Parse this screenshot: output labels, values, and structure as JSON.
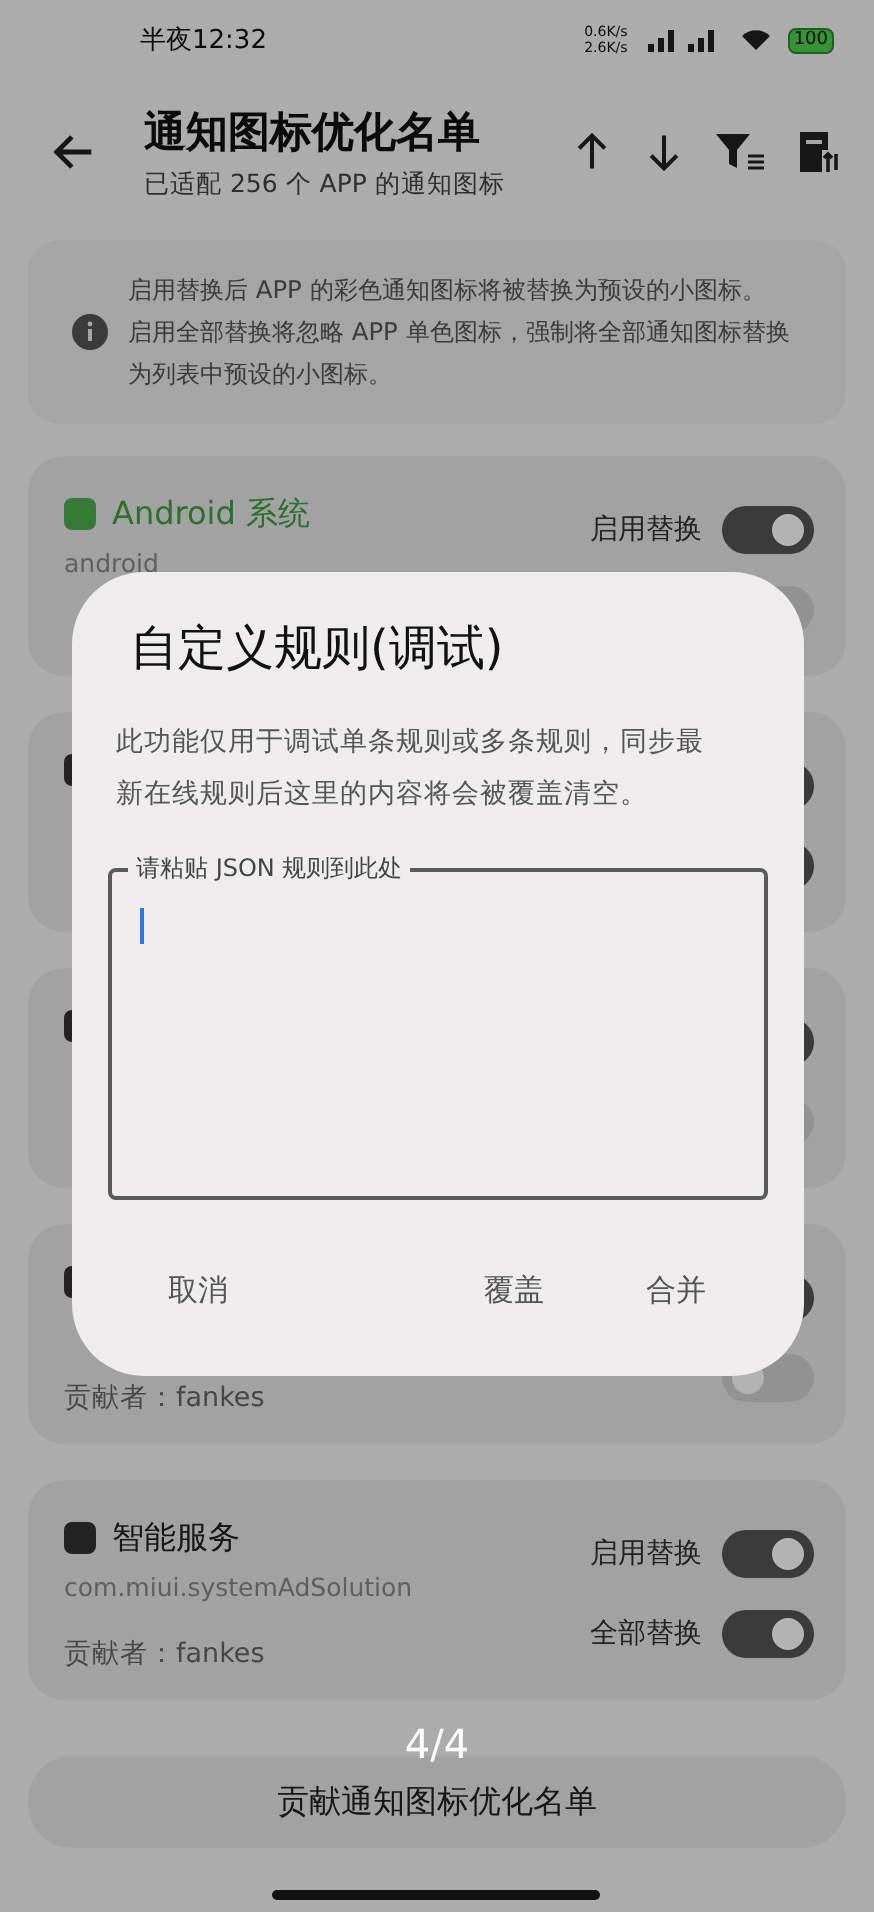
{
  "status_bar": {
    "time": "半夜12:32",
    "net_up": "0.6K/s",
    "net_down": "2.6K/s",
    "battery": "100"
  },
  "header": {
    "title": "通知图标优化名单",
    "subtitle": "已适配 256 个 APP 的通知图标"
  },
  "info": {
    "lines": [
      "启用替换后 APP 的彩色通知图标将被替换为预设的小图标。",
      "启用全部替换将忽略 APP 单色图标，强制将全部通知图标替换为列表中预设的小图标。"
    ]
  },
  "apps": [
    {
      "kind": "system",
      "title": "Android 系统",
      "package": "android",
      "switches": [
        {
          "label": "启用替换",
          "on": true
        },
        {
          "on": false
        }
      ]
    },
    {
      "kind": "app",
      "switches": [
        {
          "on": true
        },
        {
          "on": true
        }
      ]
    },
    {
      "kind": "app",
      "switches": [
        {
          "on": true
        },
        {
          "on": false
        }
      ]
    },
    {
      "kind": "app",
      "contributor": "贡献者：fankes",
      "switches": [
        {
          "on": true
        },
        {
          "on": false
        }
      ]
    },
    {
      "kind": "app",
      "title": "智能服务",
      "package": "com.miui.systemAdSolution",
      "contributor": "贡献者：fankes",
      "switches": [
        {
          "label": "启用替换",
          "on": true
        },
        {
          "label": "全部替换",
          "on": true
        }
      ]
    }
  ],
  "page_indicator": "4/4",
  "contribute_button": "贡献通知图标优化名单",
  "dialog": {
    "title": "自定义规则(调试)",
    "description": "此功能仅用于调试单条规则或多条规则，同步最新在线规则后这里的内容将会被覆盖清空。",
    "field_label": "请粘贴 JSON 规则到此处",
    "buttons": [
      "取消",
      "覆盖",
      "合并"
    ]
  }
}
